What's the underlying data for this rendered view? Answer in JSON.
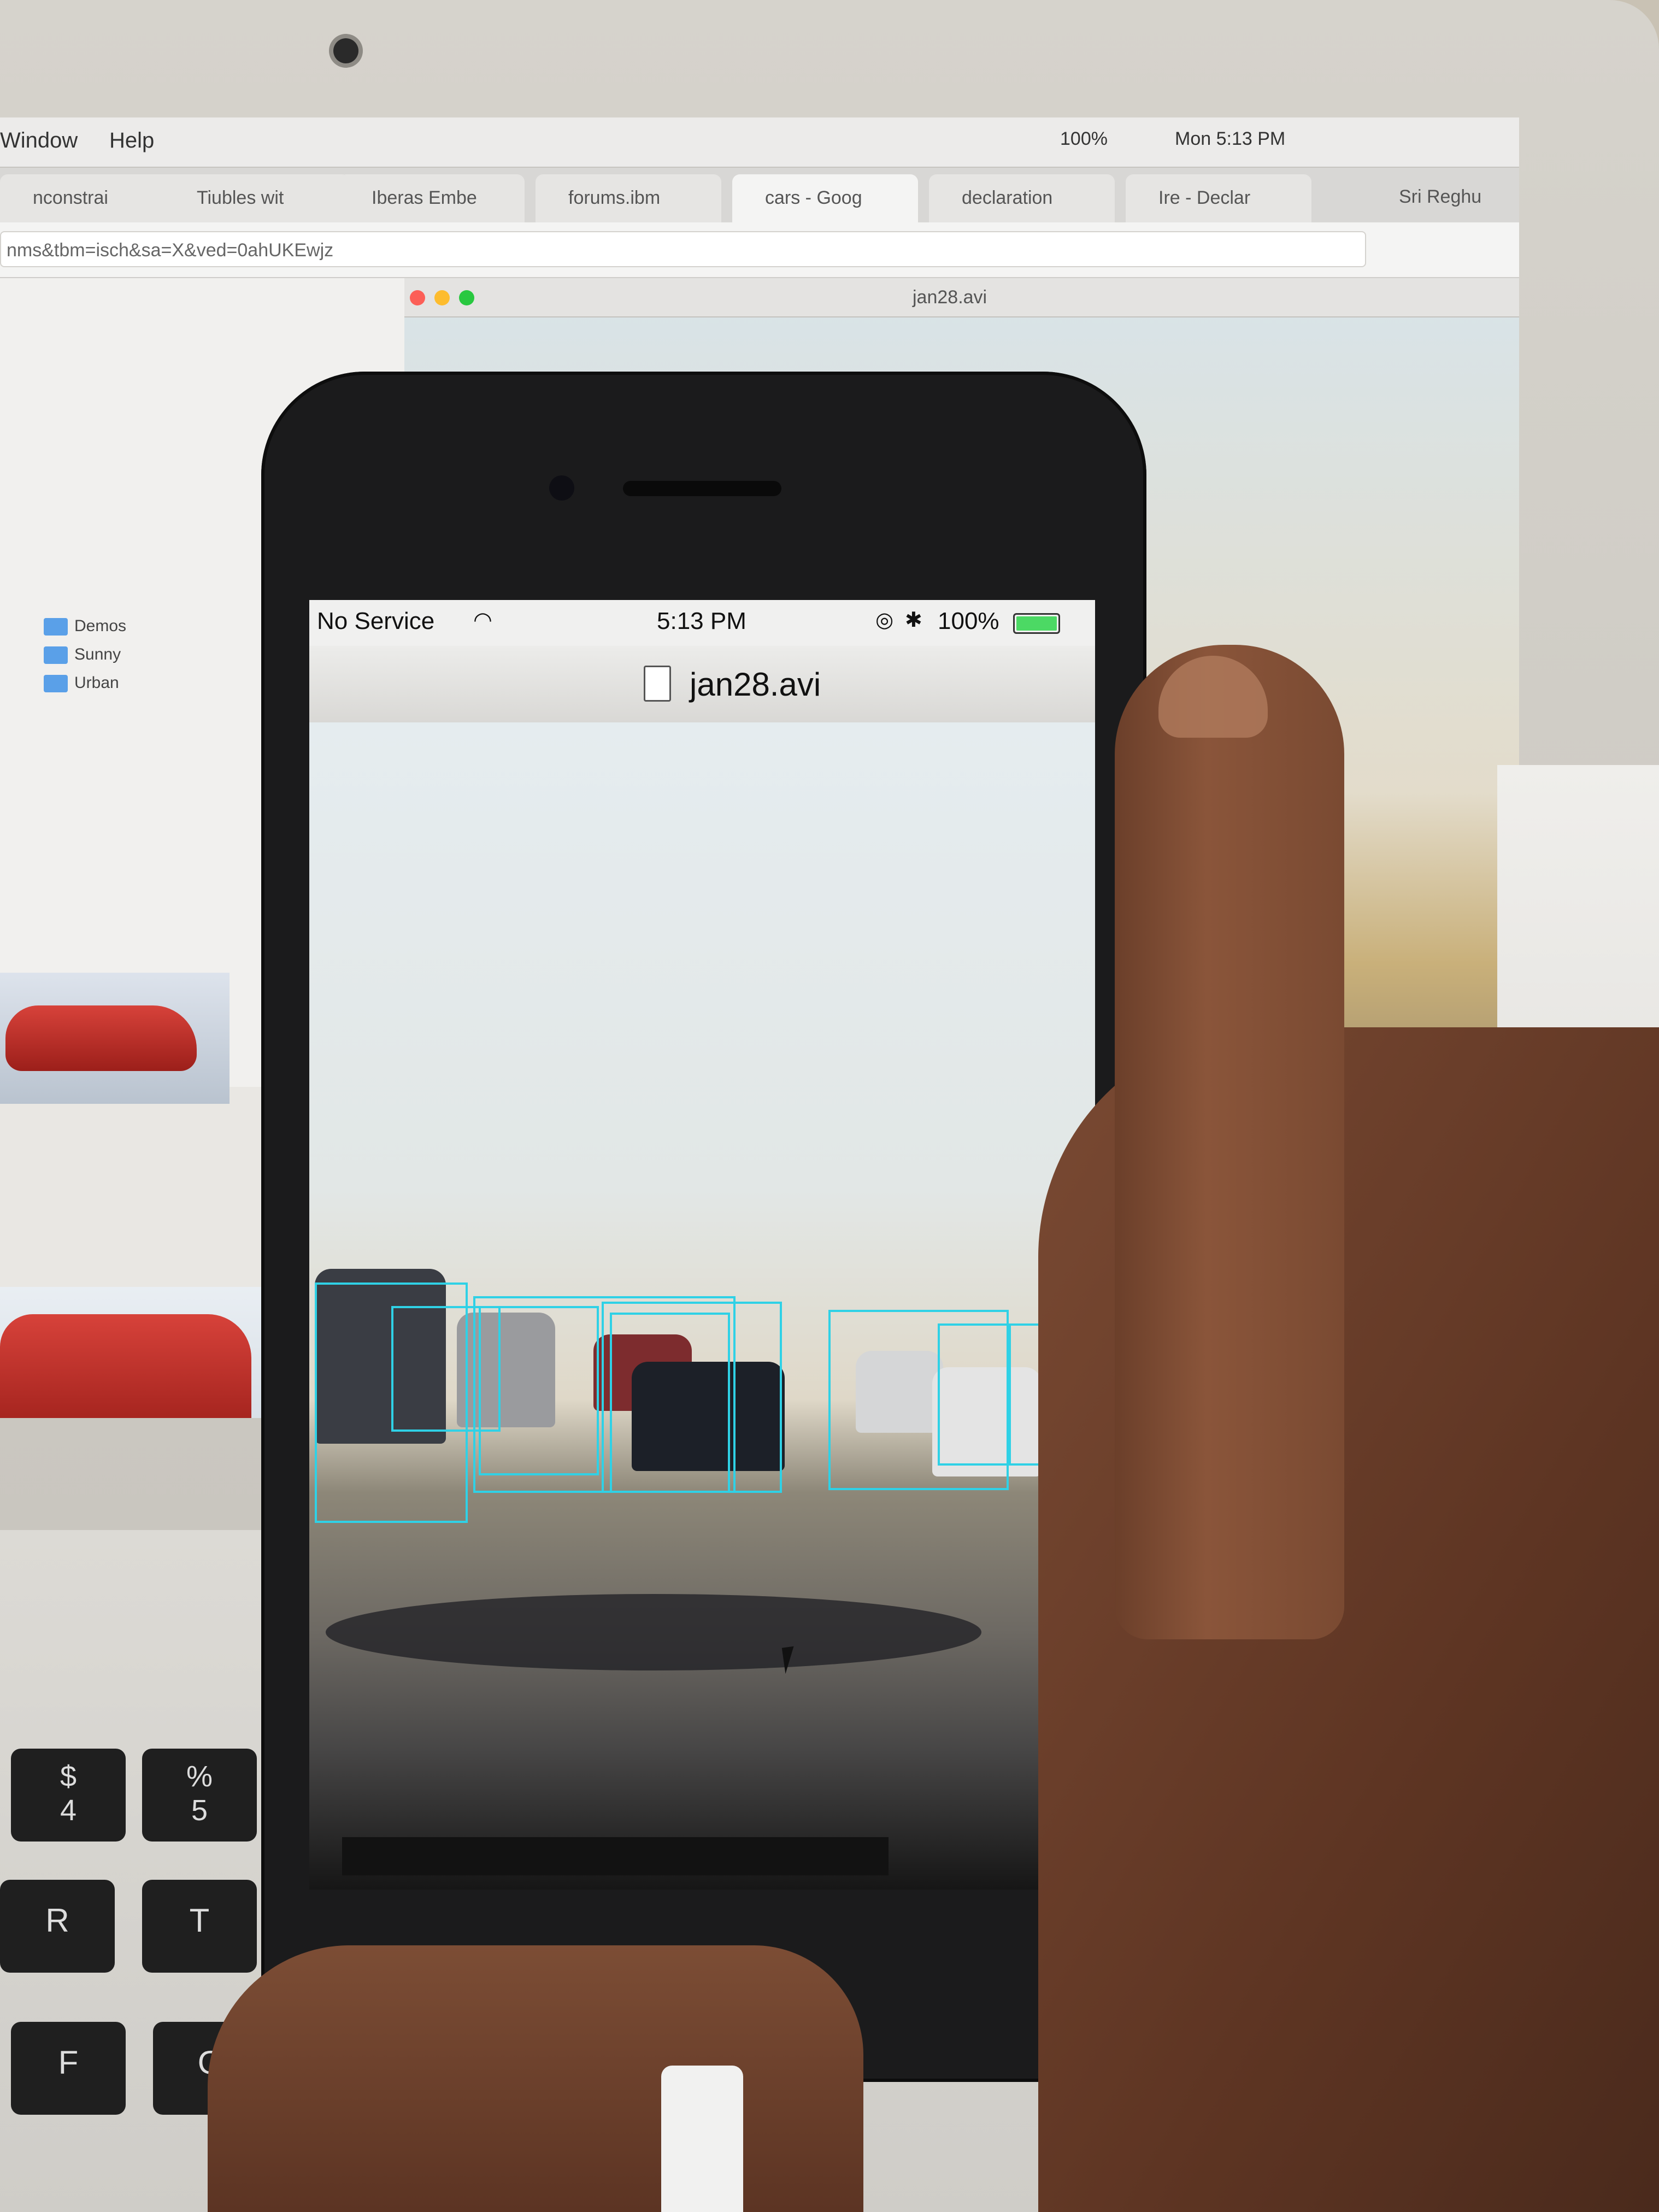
{
  "laptop": {
    "menubar": {
      "items": [
        "Window",
        "Help"
      ],
      "battery_text": "100%",
      "clock": "Mon 5:13 PM"
    },
    "browser_tabs": [
      "nconstrai",
      "Tiubles wit",
      "Iberas Embe",
      "forums.ibm",
      "cars - Goog",
      "declaration",
      "Ire - Declar"
    ],
    "profile_name": "Sri Reghu",
    "url_text": "nms&tbm=isch&sa=X&ved=0ahUKEwjz",
    "finder_items": [
      "Demos",
      "Sunny",
      "Urban"
    ],
    "video_window_title": "jan28.avi"
  },
  "phone": {
    "status": {
      "carrier": "No Service",
      "time": "5:13 PM",
      "battery": "100%"
    },
    "video_title": "jan28.avi",
    "detections_color": "#2fd1e6",
    "detection_count": 9
  },
  "keyboard": {
    "keys": [
      "$\n4",
      "%\n5",
      "R",
      "T",
      "F",
      "G"
    ]
  }
}
